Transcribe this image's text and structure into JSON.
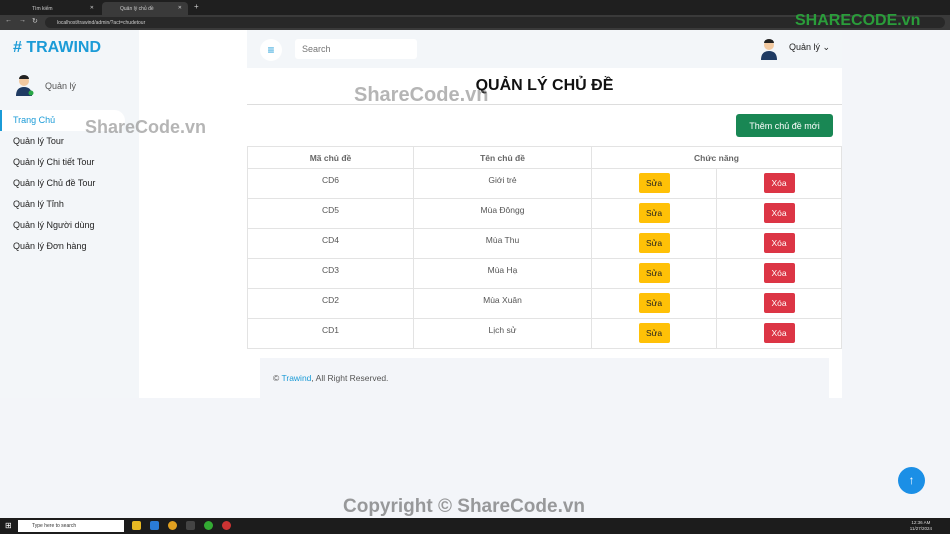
{
  "browser": {
    "tabs": [
      {
        "label": "Tìm kiếm"
      },
      {
        "label": "Quản lý chủ đề"
      }
    ],
    "url": "localhost/trawind/admin/?act=chudetour"
  },
  "sidebar": {
    "logo": "# TRAWIND",
    "user": "Quản lý",
    "items": [
      {
        "label": "Trang Chủ",
        "active": true
      },
      {
        "label": "Quản lý Tour"
      },
      {
        "label": "Quản lý Chi tiết Tour"
      },
      {
        "label": "Quản lý Chủ đề Tour"
      },
      {
        "label": "Quản lý Tỉnh"
      },
      {
        "label": "Quản lý Người dùng"
      },
      {
        "label": "Quản lý Đơn hàng"
      }
    ]
  },
  "header": {
    "search_placeholder": "Search",
    "user": "Quản lý ⌄"
  },
  "main": {
    "title": "QUẢN LÝ CHỦ ĐỀ",
    "add_label": "Thêm chủ đề mới",
    "columns": [
      "Mã chủ đề",
      "Tên chủ đề",
      "Chức năng"
    ],
    "rows": [
      {
        "id": "CD6",
        "name": "Giới trẻ"
      },
      {
        "id": "CD5",
        "name": "Mùa Đôngg"
      },
      {
        "id": "CD4",
        "name": "Mùa Thu"
      },
      {
        "id": "CD3",
        "name": "Mùa Hạ"
      },
      {
        "id": "CD2",
        "name": "Mùa Xuân"
      },
      {
        "id": "CD1",
        "name": "Lịch sử"
      }
    ],
    "edit_label": "Sửa",
    "delete_label": "Xóa"
  },
  "footer": {
    "prefix": "© ",
    "brand": "Trawind",
    "suffix": ", All Right Reserved."
  },
  "watermarks": {
    "a": "ShareCode.vn",
    "b": "ShareCode.vn",
    "c": "Copyright © ShareCode.vn",
    "logo": "SHARECODE.vn"
  },
  "taskbar": {
    "search": "Type here to search",
    "time": "12:36 AM",
    "date": "11/27/2024"
  },
  "colors": {
    "accent": "#1b9bd7",
    "add": "#198754",
    "edit": "#ffc107",
    "delete": "#dc3545"
  }
}
